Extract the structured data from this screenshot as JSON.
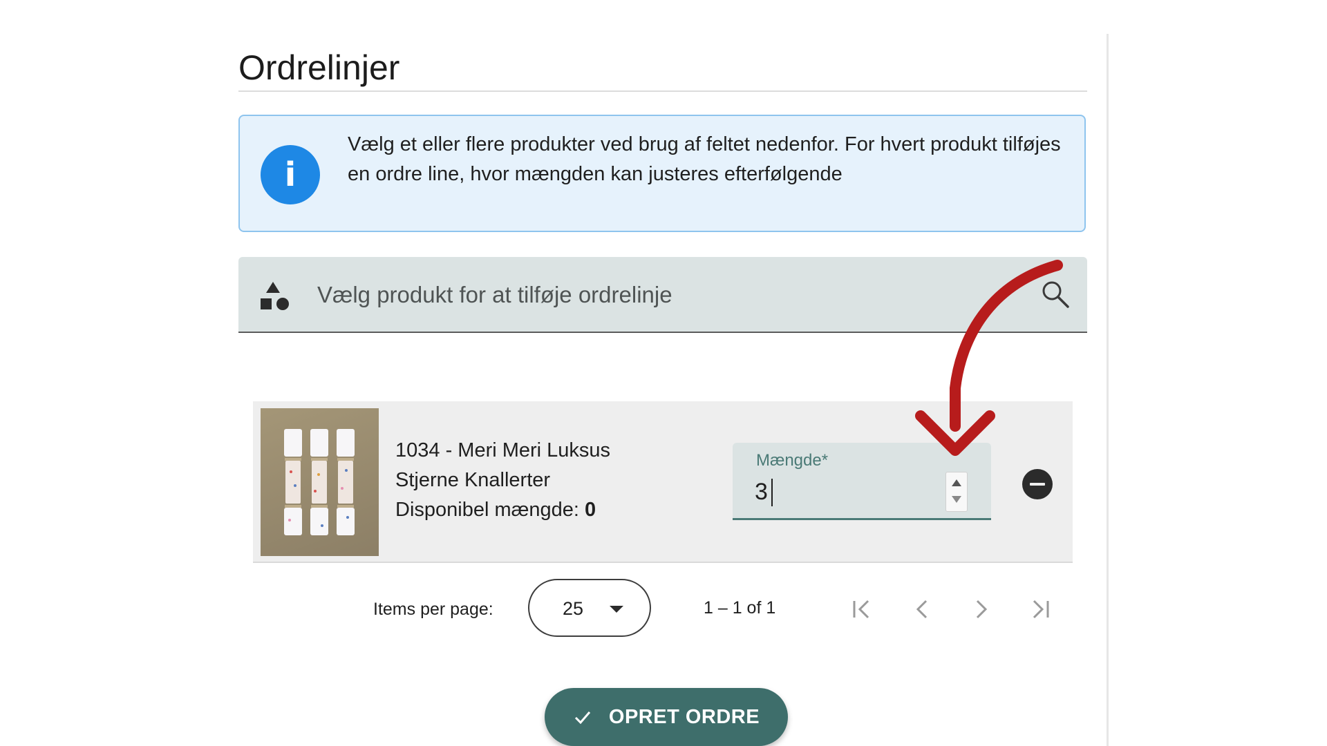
{
  "section": {
    "title": "Ordrelinjer"
  },
  "info": {
    "icon": "info-icon",
    "text": "Vælg et eller flere produkter ved brug af feltet nedenfor. For hvert produkt tilføjes en ordre line, hvor mængden kan justeres efterfølgende",
    "accent_color": "#1e88e5"
  },
  "product_search": {
    "icon": "shapes-icon",
    "placeholder": "Vælg produkt for at tilføje ordrelinje",
    "search_icon": "search-icon"
  },
  "order_lines": [
    {
      "name_line1": "1034 - Meri Meri Luksus",
      "name_line2": "Stjerne Knallerter",
      "availability_label": "Disponibel mængde:",
      "availability_value": "0",
      "quantity_label": "Mængde*",
      "quantity_value": "3",
      "remove_icon": "minus-circle-icon"
    }
  ],
  "paginator": {
    "items_per_page_label": "Items per page:",
    "page_size": "25",
    "range_label": "1 – 1 of 1",
    "first_icon": "first-page-icon",
    "prev_icon": "chevron-left-icon",
    "next_icon": "chevron-right-icon",
    "last_icon": "last-page-icon"
  },
  "actions": {
    "create_order_label": "OPRET ORDRE",
    "create_order_icon": "check-icon",
    "primary_color": "#3e6e6b"
  },
  "annotation": {
    "arrow_color": "#b71c1c"
  }
}
